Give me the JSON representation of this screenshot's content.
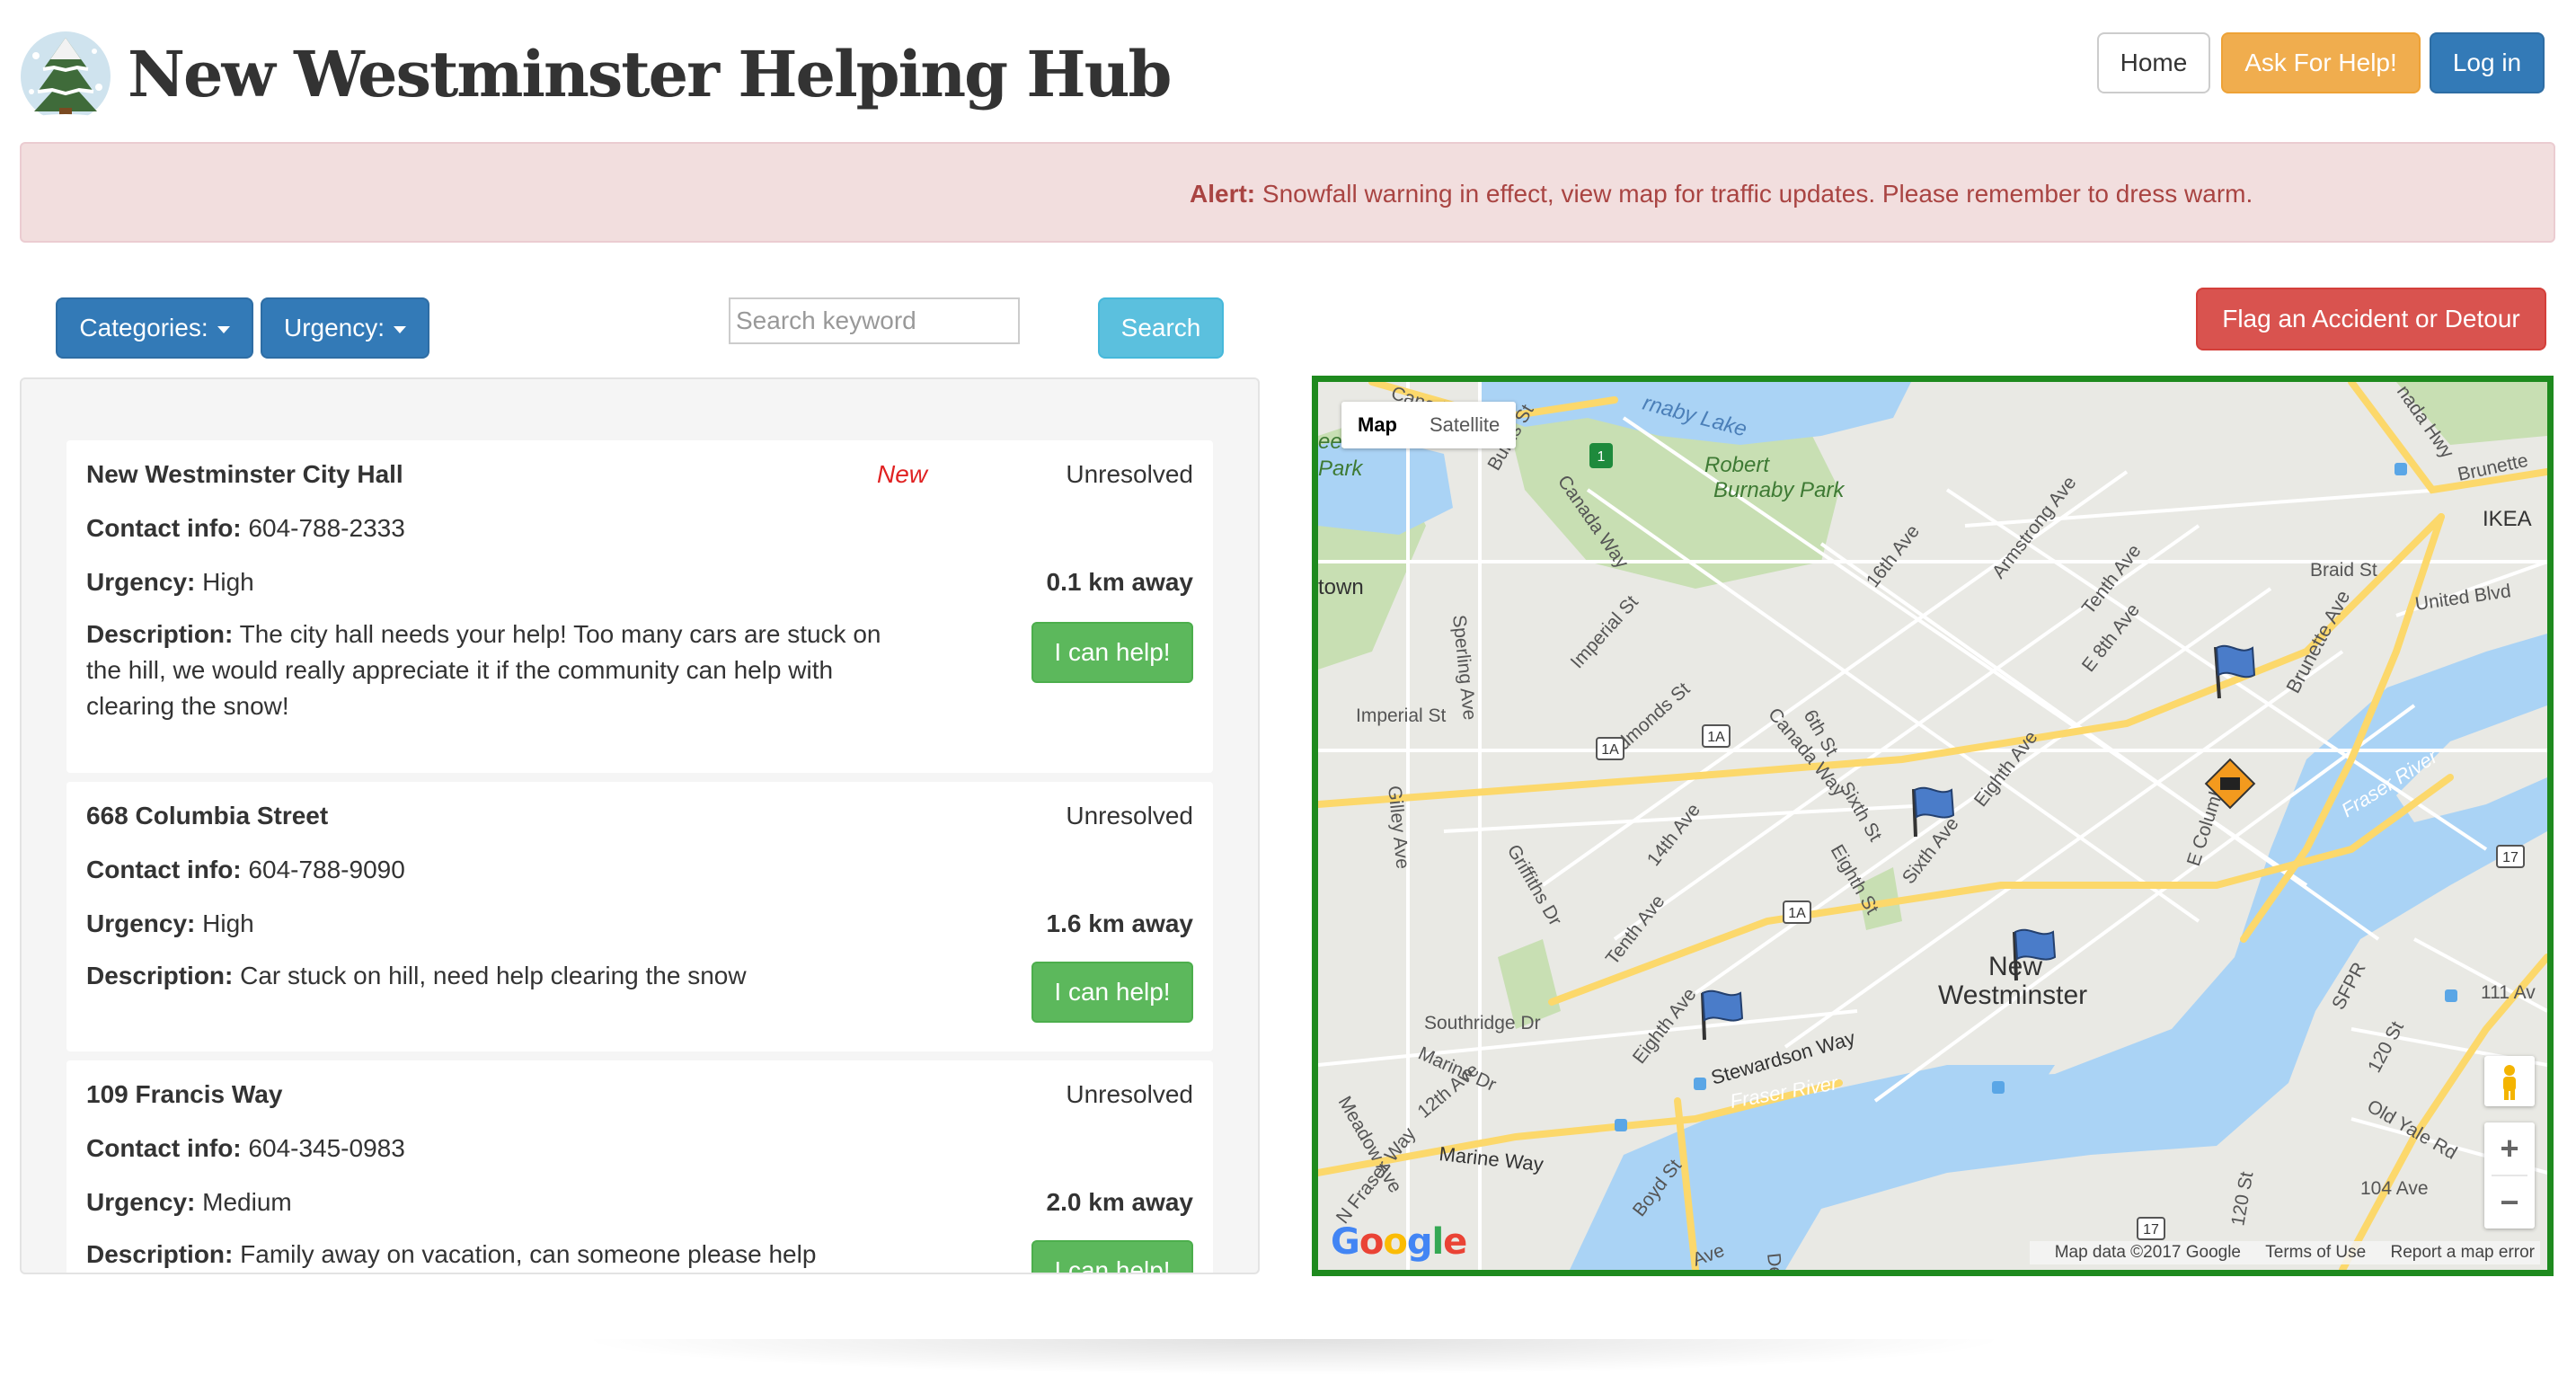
{
  "header": {
    "title": "New Westminster Helping Hub",
    "nav": {
      "home": "Home",
      "ask": "Ask For Help!",
      "login": "Log in"
    }
  },
  "alert": {
    "label": "Alert:",
    "message": " Snowfall warning in effect, view map for traffic updates. Please remember to dress warm."
  },
  "toolbar": {
    "categories": "Categories:",
    "urgency": "Urgency:",
    "search_placeholder": "Search keyword",
    "search": "Search",
    "flag": "Flag an Accident or Detour"
  },
  "requests": [
    {
      "title": "New Westminster City Hall",
      "badge": "New",
      "status": "Unresolved",
      "contact_label": "Contact info:",
      "contact": " 604-788-2333",
      "urgency_label": "Urgency:",
      "urgency": " High",
      "distance": "0.1 km away",
      "desc_label": "Description:",
      "description": " The city hall needs your help! Too many cars are stuck on the hill, we would really appreciate it if the community can help with clearing the snow!",
      "action": "I can help!"
    },
    {
      "title": "668 Columbia Street",
      "status": "Unresolved",
      "contact_label": "Contact info:",
      "contact": " 604-788-9090",
      "urgency_label": "Urgency:",
      "urgency": " High",
      "distance": "1.6 km away",
      "desc_label": "Description:",
      "description": " Car stuck on hill, need help clearing the snow",
      "action": "I can help!"
    },
    {
      "title": "109 Francis Way",
      "status": "Unresolved",
      "contact_label": "Contact info:",
      "contact": " 604-345-0983",
      "urgency_label": "Urgency:",
      "urgency": " Medium",
      "distance": "2.0 km away",
      "desc_label": "Description:",
      "description": " Family away on vacation, can someone please help shovel",
      "action": "I can help!"
    }
  ],
  "map": {
    "type_map": "Map",
    "type_satellite": "Satellite",
    "labels": {
      "lake": "rnaby Lake",
      "hwy_top": "Canada Hwy",
      "hwy_right": "nada Hwy",
      "park_left": "eer",
      "park_left2": "Park",
      "robert1": "Robert",
      "robert2": "Burnaby Park",
      "town": "town",
      "imperial": "Imperial St",
      "city1": "New",
      "city2": "Westminster",
      "fraser_river": "Fraser River",
      "fraser_river2": "Fraser River",
      "ikea": "IKEA",
      "united": "United Blvd",
      "braid": "Braid St",
      "brunette": "Brunette Ave",
      "brunette2": "Brunette",
      "stewardson": "Stewardson Way",
      "marine": "Marine Way",
      "southridge": "Southridge Dr",
      "marine_dr": "Marine Dr",
      "twelfth": "12th Ave",
      "meadow": "Meadow Ave",
      "nfraser": "N Fraser Way",
      "boyd": "Boyd St",
      "eighth": "Eighth Ave",
      "tenth": "Tenth Ave",
      "fourteenth": "14th Ave",
      "sixteenth": "16th Ave",
      "armstrong": "Armstrong Ave",
      "tenth2": "Tenth Ave",
      "e8th": "E 8th Ave",
      "eighth2": "Eighth Ave",
      "sixth": "Sixth St",
      "sixth_ave": "Sixth Ave",
      "eighth_st": "Eighth St",
      "sixth_st2": "6th St",
      "canada_way": "Canada Way",
      "canada_way2": "Canada Way",
      "edmonds": "Edmonds St",
      "griffiths": "Griffiths Dr",
      "gilley": "Gilley Ave",
      "sperling": "Sperling Ave",
      "burris": "Burris St",
      "imperial2": "Imperial St",
      "ecolumbia": "E Columbia",
      "sfpr": "SFPR",
      "ave111": "111 Av",
      "st120": "120 St",
      "st120b": "120 St",
      "oldyale": "Old Yale Rd",
      "ave104": "104 Ave",
      "shield1a": "1A",
      "shield17": "17",
      "shield1": "1",
      "der": "Der",
      "ave_bottom": "Ave"
    },
    "footer_data": "Map data ©2017 Google",
    "footer_terms": "Terms of Use",
    "footer_report": "Report a map error",
    "google": "Google"
  }
}
